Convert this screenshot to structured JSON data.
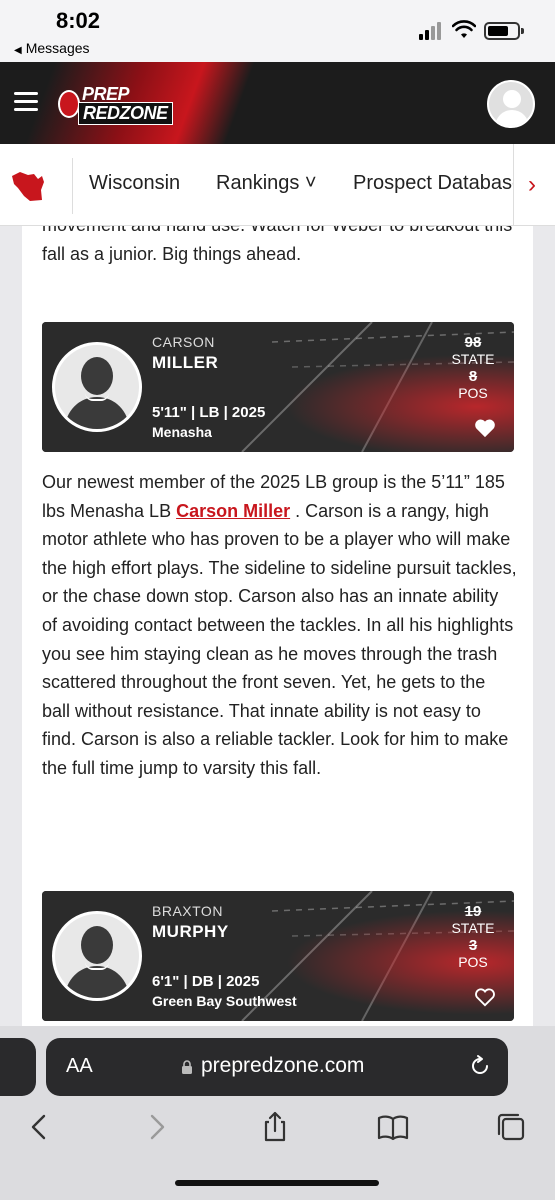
{
  "status_bar": {
    "time": "8:02",
    "back_app": "Messages"
  },
  "site": {
    "logo_line1": "PREP",
    "logo_line2": "REDZONE",
    "nav": [
      {
        "label": "Wisconsin"
      },
      {
        "label": "Rankings ˅"
      },
      {
        "label": "Prospect Database"
      }
    ]
  },
  "article": {
    "intro_text": "movement and hand use. Watch for Weber to breakout this fall as a junior. Big things ahead.",
    "cards": [
      {
        "first_name": "CARSON",
        "last_name": "MILLER",
        "meta": "5'11\" | LB | 2025",
        "school": "Menasha",
        "state_rank": "98",
        "state_label": "STATE",
        "pos_rank": "8",
        "pos_label": "POS",
        "favorited": true
      },
      {
        "first_name": "BRAXTON",
        "last_name": "MURPHY",
        "meta": "6'1\" | DB | 2025",
        "school": "Green Bay Southwest",
        "state_rank": "19",
        "state_label": "STATE",
        "pos_rank": "3",
        "pos_label": "POS",
        "favorited": false
      }
    ],
    "miller_para": {
      "before": "Our newest member of the 2025 LB group is the 5’11” 185 lbs Menasha LB ",
      "link": "Carson Miller",
      "after": " . Carson is a rangy, high motor athlete who has proven to be a player who will make the high effort plays. The sideline to sideline pursuit tackles, or the chase down stop. Carson also has an innate ability of avoiding contact between the tackles. In all his highlights you see him staying clean as he moves through the trash scattered throughout the front seven. Yet, he gets to the ball without resistance. That innate ability is not easy to find. Carson is also a reliable tackler. Look for him to make the full time jump to varsity this fall."
    }
  },
  "browser": {
    "aa_label": "AA",
    "url": "prepredzone.com"
  },
  "colors": {
    "brand_red": "#c8161d",
    "header_bg": "#1c1c1c"
  }
}
